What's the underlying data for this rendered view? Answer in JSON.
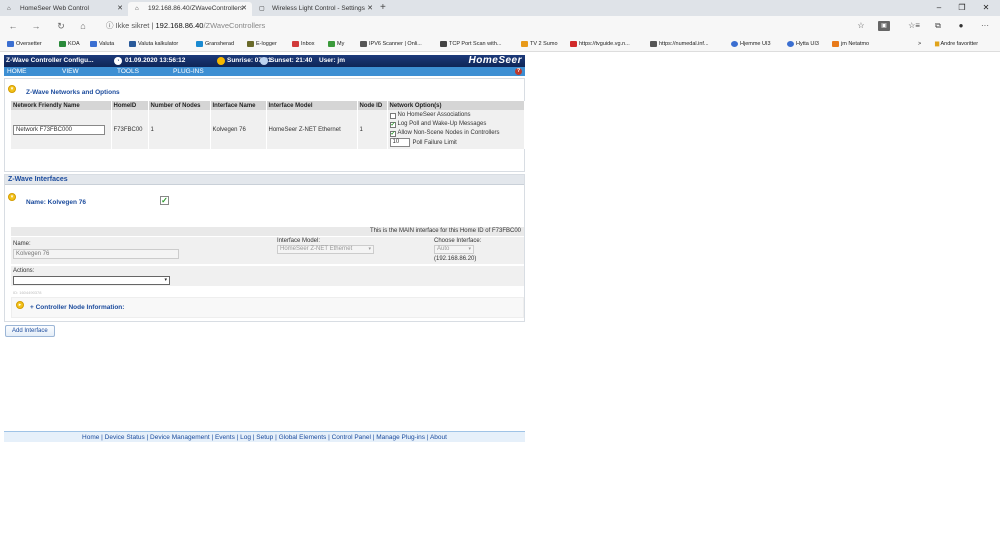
{
  "browser": {
    "tabs": [
      {
        "title": "HomeSeer Web Control",
        "icon": "homeseer-icon"
      },
      {
        "title": "192.168.86.40/ZWaveControllers",
        "icon": "homeseer-icon"
      },
      {
        "title": "Wireless Light Control - Settings",
        "icon": "page-icon"
      }
    ],
    "new_tab": "+",
    "window_controls": [
      "–",
      "❐",
      "✕"
    ],
    "nav": {
      "back": "←",
      "forward": "→",
      "reload": "↻",
      "home": "⌂"
    },
    "address": {
      "security": "Ikke sikret",
      "separator": "|",
      "host": "192.168.86.40",
      "path": "/ZWaveControllers"
    },
    "right_icons": [
      "☆",
      "▣",
      "☆≡",
      "⧉",
      "●",
      "···"
    ],
    "favorites": [
      {
        "label": "Oversetter",
        "color": "#3b6fd1"
      },
      {
        "label": "KOA",
        "color": "#2a8a3a"
      },
      {
        "label": "Valuta",
        "color": "#3b6fd1"
      },
      {
        "label": "Valuta kalkulator",
        "color": "#2a5a9a"
      },
      {
        "label": "Gransherad",
        "color": "#1a8ad1"
      },
      {
        "label": "E-logger",
        "color": "#6a6a2a"
      },
      {
        "label": "Inbox",
        "color": "#d13b3b"
      },
      {
        "label": "My",
        "color": "#3b9a3b"
      },
      {
        "label": "IPV6 Scanner | Onli...",
        "color": "#555555"
      },
      {
        "label": "TCP Port Scan with...",
        "color": "#444444"
      },
      {
        "label": "TV 2 Sumo",
        "color": "#e89a1a"
      },
      {
        "label": "https://tvguide.vg.n...",
        "color": "#d12a2a"
      },
      {
        "label": "https://numedal.inf...",
        "color": "#555555"
      },
      {
        "label": "Hjemme UI3",
        "color": "#3b6fd1"
      },
      {
        "label": "Hytta UI3",
        "color": "#3b6fd1"
      },
      {
        "label": "jm Netatmo",
        "color": "#e87a1a"
      }
    ],
    "favorites_more": ">",
    "other_favorites": "Andre favoritter"
  },
  "app": {
    "header": {
      "title": "Z-Wave Controller Configu...",
      "datetime": "01.09.2020 13:56:12",
      "sunrise": "Sunrise: 07:31",
      "sunset": "Sunset: 21:40",
      "user": "User: jm",
      "logo": "HomeSeer"
    },
    "menu": [
      "HOME",
      "VIEW",
      "TOOLS",
      "PLUG-INS"
    ],
    "networks": {
      "title": "Z-Wave Networks and Options",
      "columns": [
        "Network Friendly Name",
        "HomeID",
        "Number of Nodes",
        "Interface Name",
        "Interface Model",
        "Node ID",
        "Network Option(s)"
      ],
      "row": {
        "friendly_name": "Network F73FBC000",
        "home_id": "F73FBC00",
        "nodes": "1",
        "interface_name": "Kolvegen 76",
        "interface_model": "HomeSeer Z-NET Ethernet",
        "node_id": "1",
        "options": [
          {
            "label": "No HomeSeer Associations",
            "checked": false
          },
          {
            "label": "Log Poll and Wake-Up Messages",
            "checked": true
          },
          {
            "label": "Allow Non-Scene Nodes in Controllers",
            "checked": true
          }
        ],
        "poll_failure_value": "10",
        "poll_failure_label": "Poll Failure Limit"
      }
    },
    "interfaces": {
      "title": "Z-Wave Interfaces",
      "name_label": "Name: Kolvegen 76",
      "enabled": true,
      "main_note": "This is the MAIN interface for this Home ID of F73FBC00",
      "name_field_label": "Name:",
      "name_value": "Kolvegen 76",
      "model_label": "Interface Model:",
      "model_value": "HomeSeer Z-NET Ethernet",
      "choose_label": "Choose Interface:",
      "choose_value": "Auto",
      "ip": "(192.168.86.20)",
      "actions_label": "Actions:",
      "id_text": "ID: 1604490378",
      "node_info": "+ Controller Node Information:"
    },
    "add_interface": "Add Interface",
    "footer": "Home | Device Status | Device Management | Events | Log | Setup | Global Elements | Control Panel | Manage Plug-ins | About"
  }
}
